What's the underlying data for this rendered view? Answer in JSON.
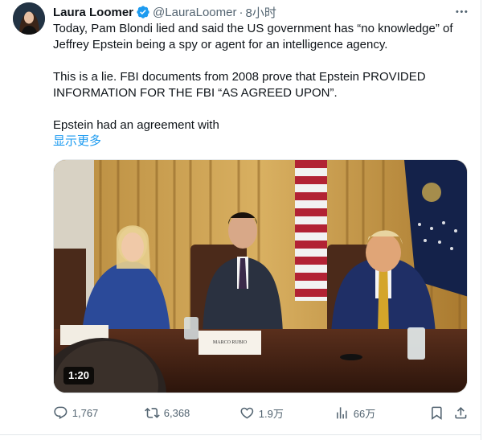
{
  "tweet": {
    "author_name": "Laura Loomer",
    "handle": "@LauraLoomer",
    "separator": "·",
    "time": "8小时",
    "paragraphs": [
      "Today, Pam Blondi lied and said the US government has “no knowledge” of Jeffrey Epstein being a spy or agent for an intelligence agency.",
      "This is a lie. FBI documents from 2008 prove that Epstein PROVIDED INFORMATION FOR THE FBI “AS AGREED UPON”.",
      "Epstein had an agreement with"
    ],
    "show_more": "显示更多",
    "media": {
      "duration": "1:20",
      "placard_text": "MARCO RUBIO"
    },
    "actions": {
      "replies": "1,767",
      "reposts": "6,368",
      "likes": "1.9万",
      "views": "66万"
    }
  },
  "colors": {
    "accent": "#1d9bf0",
    "secondary_text": "#536471",
    "primary_text": "#0f1419"
  }
}
